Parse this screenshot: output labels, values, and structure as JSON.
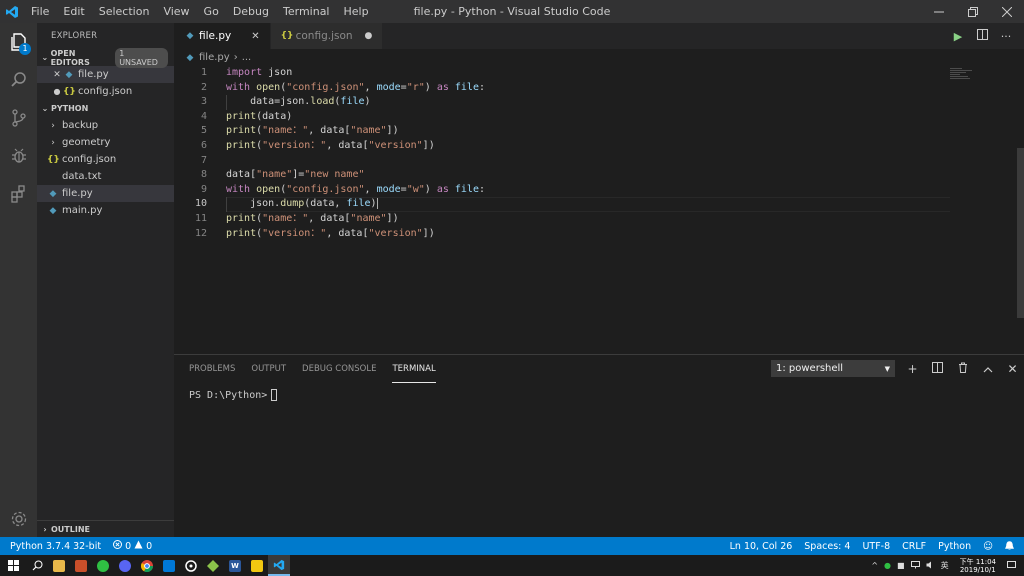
{
  "menu": [
    "File",
    "Edit",
    "Selection",
    "View",
    "Go",
    "Debug",
    "Terminal",
    "Help"
  ],
  "window_title": "file.py - Python - Visual Studio Code",
  "activity": {
    "explorer_badge": "1"
  },
  "sidebar": {
    "title": "EXPLORER",
    "open_editors_label": "OPEN EDITORS",
    "unsaved_badge": "1 UNSAVED",
    "open_editors": [
      {
        "name": "file.py"
      },
      {
        "name": "config.json"
      }
    ],
    "folder_label": "PYTHON",
    "tree": [
      {
        "name": "backup"
      },
      {
        "name": "geometry"
      },
      {
        "name": "config.json"
      },
      {
        "name": "data.txt"
      },
      {
        "name": "file.py"
      },
      {
        "name": "main.py"
      }
    ],
    "outline_label": "OUTLINE"
  },
  "tabs": [
    {
      "label": "file.py"
    },
    {
      "label": "config.json"
    }
  ],
  "breadcrumb": {
    "file": "file.py",
    "rest": "..."
  },
  "code": {
    "line_numbers": [
      "1",
      "2",
      "3",
      "4",
      "5",
      "6",
      "7",
      "8",
      "9",
      "10",
      "11",
      "12"
    ],
    "current_line": "10"
  },
  "panel": {
    "tabs": [
      "PROBLEMS",
      "OUTPUT",
      "DEBUG CONSOLE",
      "TERMINAL"
    ],
    "terminal_select": "1: powershell",
    "prompt": "PS D:\\Python>"
  },
  "status": {
    "interpreter": "Python 3.7.4 32-bit",
    "errors": "0",
    "warnings": "0",
    "position": "Ln 10, Col 26",
    "spaces": "Spaces: 4",
    "encoding": "UTF-8",
    "eol": "CRLF",
    "language": "Python"
  },
  "taskbar": {
    "time": "下午 11:04",
    "date": "2019/10/1",
    "ime": "英"
  },
  "colors": {
    "accent": "#007acc",
    "keyword": "#c586c0",
    "function": "#dcdcaa",
    "string": "#ce9178",
    "parameter": "#9cdcfe"
  }
}
